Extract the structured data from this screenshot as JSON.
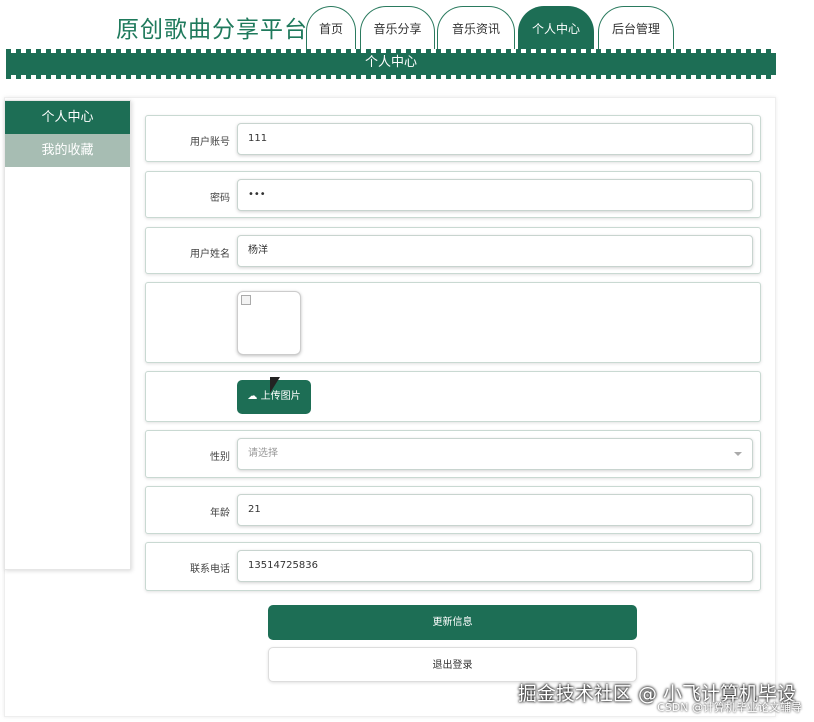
{
  "header": {
    "brand": "原创歌曲分享平台",
    "tabs": [
      {
        "label": "首页"
      },
      {
        "label": "音乐分享"
      },
      {
        "label": "音乐资讯"
      },
      {
        "label": "个人中心",
        "active": true
      },
      {
        "label": "后台管理"
      }
    ],
    "banner_title": "个人中心"
  },
  "sidebar": {
    "items": [
      {
        "label": "个人中心",
        "active": true
      },
      {
        "label": "我的收藏"
      }
    ]
  },
  "form": {
    "account": {
      "label": "用户账号",
      "value": "111"
    },
    "password": {
      "label": "密码",
      "value": "•••"
    },
    "name": {
      "label": "用户姓名",
      "value": "杨洋"
    },
    "upload_label": "上传图片",
    "gender": {
      "label": "性别",
      "placeholder": "请选择"
    },
    "age": {
      "label": "年龄",
      "value": "21"
    },
    "phone": {
      "label": "联系电话",
      "value": "13514725836"
    }
  },
  "actions": {
    "update_label": "更新信息",
    "logout_label": "退出登录"
  },
  "watermark": {
    "main": "掘金技术社区 @ 小飞计算机毕设",
    "sub": "CSDN @计算机毕业论文辅导"
  },
  "colors": {
    "accent": "#1d6e55",
    "sidebar_sub": "#a7bdb3"
  }
}
